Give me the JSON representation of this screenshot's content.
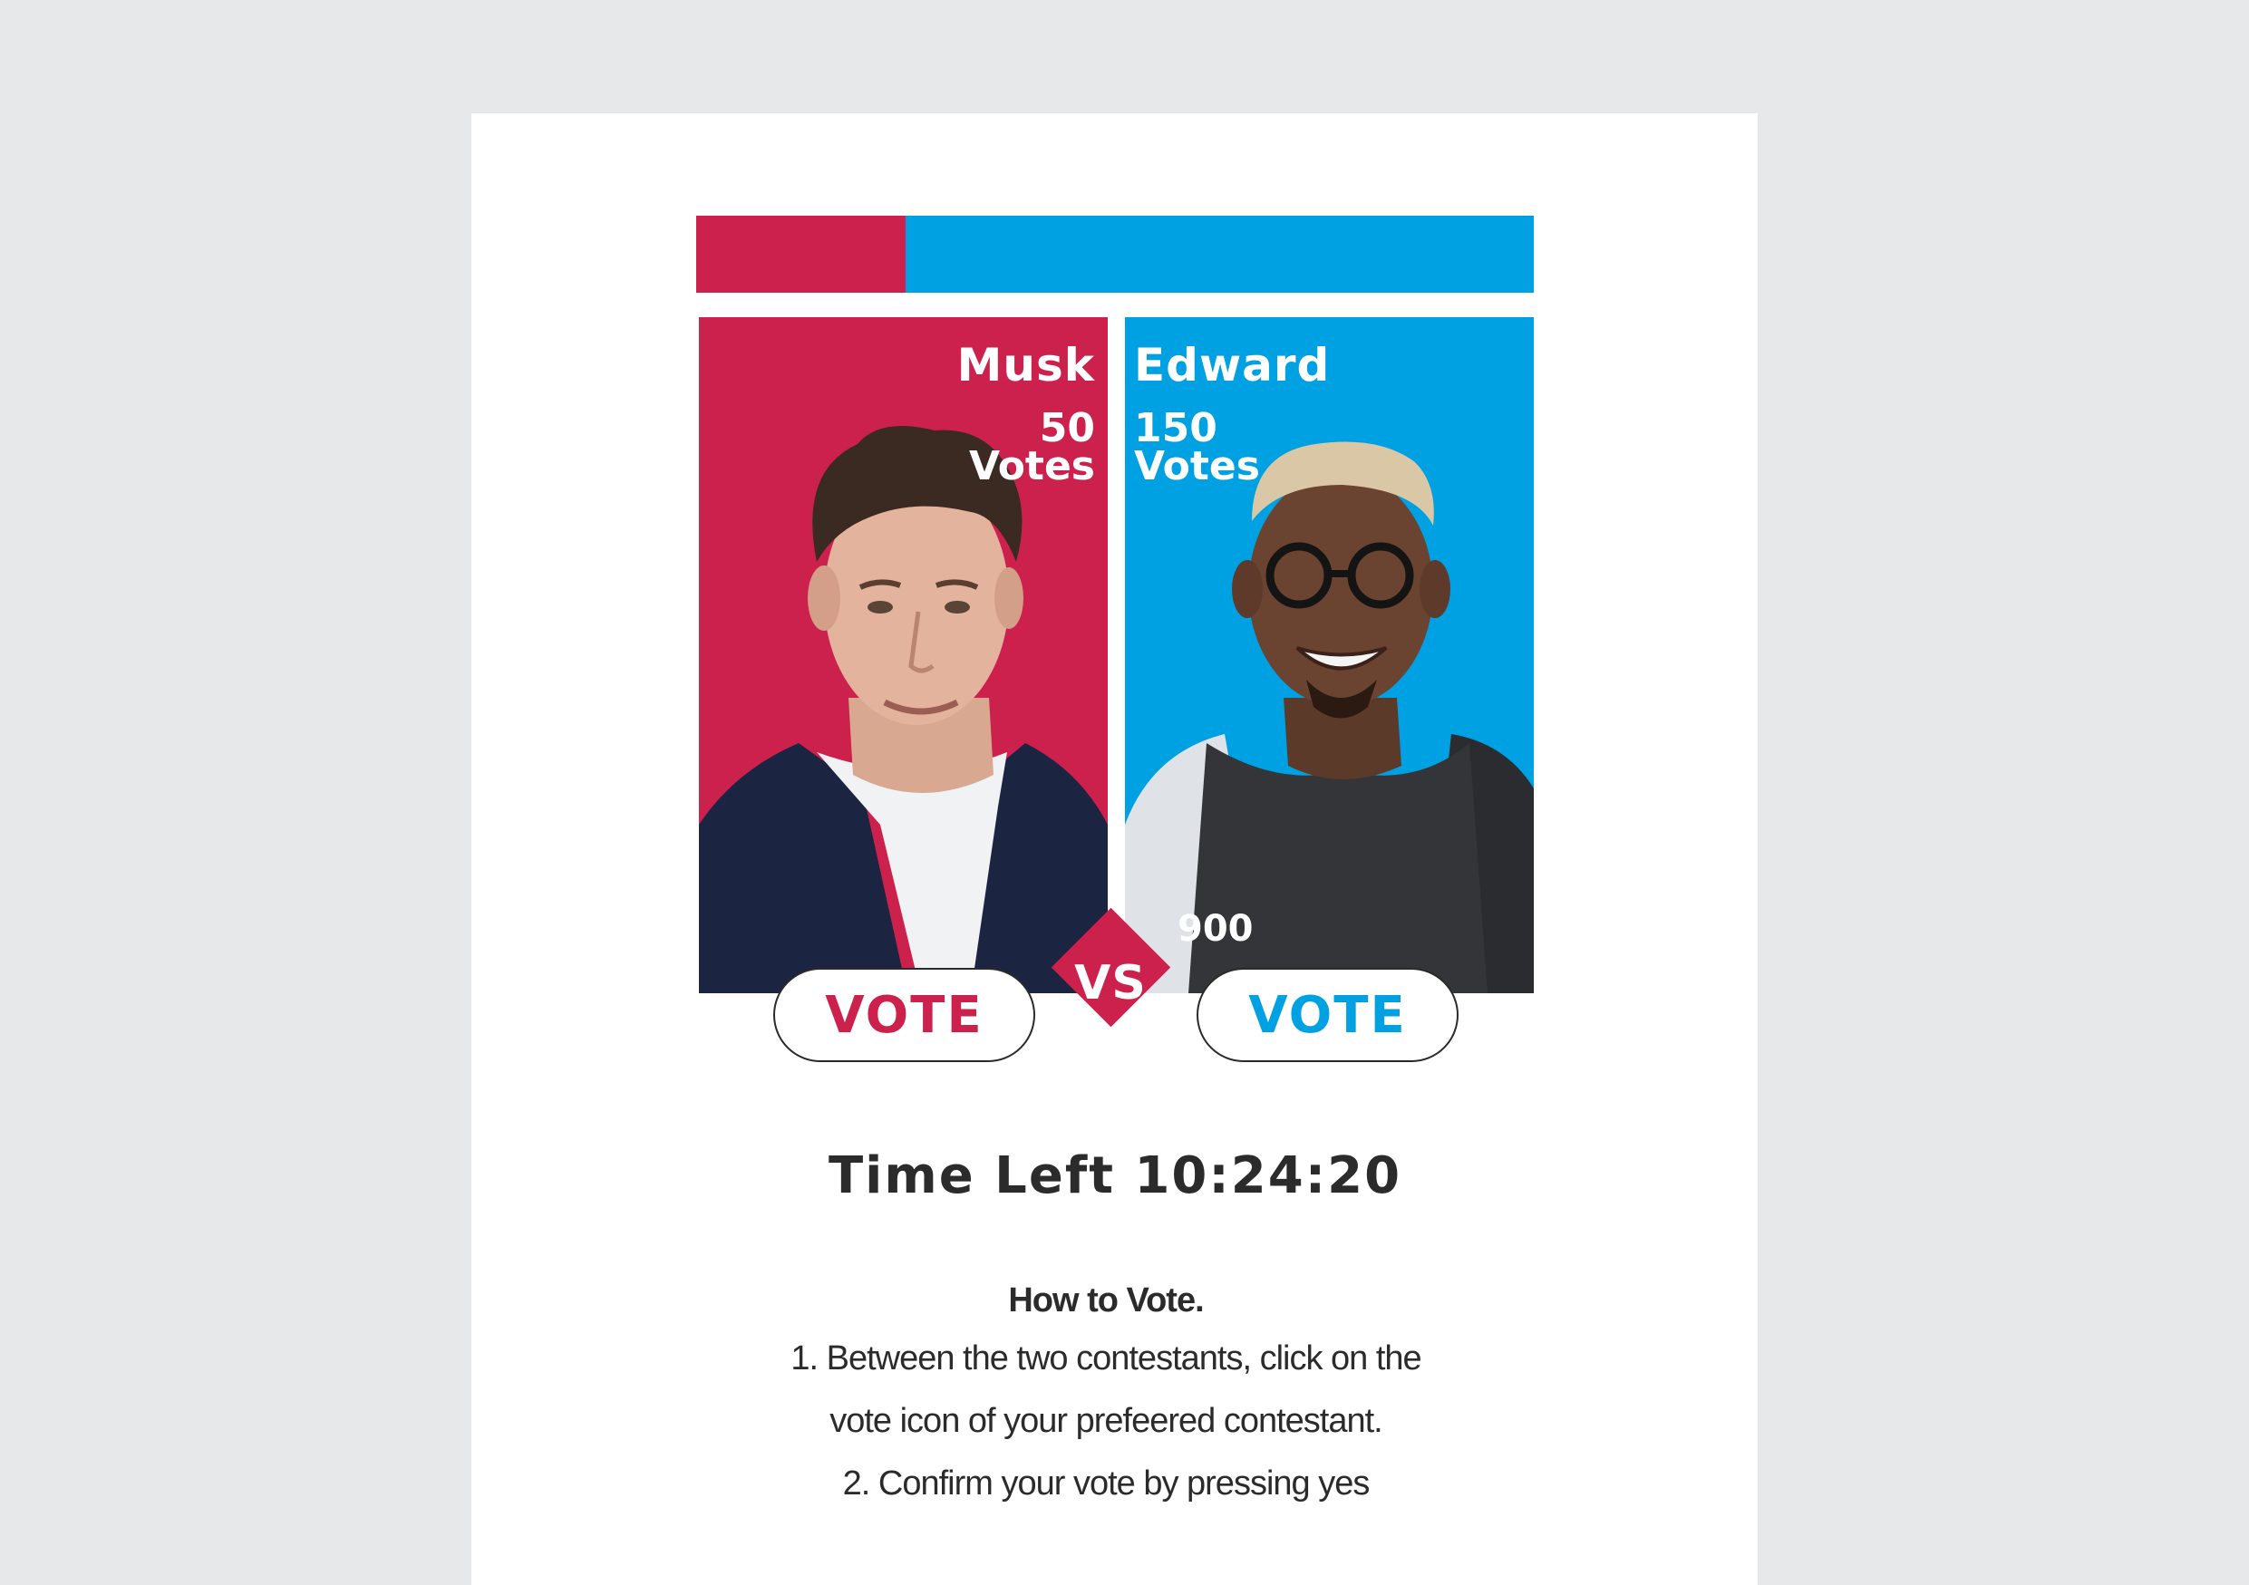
{
  "poll": {
    "progress_fraction": 0.25
  },
  "contestants": [
    {
      "name": "Musk",
      "votes_count": "50",
      "votes_unit": "Votes",
      "vote_label": "VOTE",
      "color": "#cc214c"
    },
    {
      "name": "Edward",
      "votes_count": "150",
      "votes_unit": "Votes",
      "vote_label": "VOTE",
      "color": "#00a1e2",
      "stray_count": "900"
    }
  ],
  "versus_label": "VS",
  "timer": {
    "text": "Time Left 10:24:20"
  },
  "instructions": {
    "heading": "How to Vote.",
    "lines": [
      "1. Between the two contestants, click on the",
      "vote icon of your prefeered contestant.",
      "2. Confirm your vote by pressing yes"
    ]
  },
  "colors": {
    "background": "#e7e8ea",
    "card": "#ffffff",
    "red": "#cc214c",
    "blue": "#00a1e2",
    "text": "#2b2b2b"
  }
}
